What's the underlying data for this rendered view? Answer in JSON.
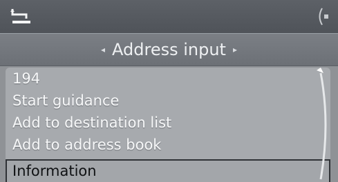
{
  "header": {
    "back_icon": "return-arrow-icon",
    "scroll_icon": "controller-direction-icon"
  },
  "title": {
    "text": "Address input",
    "left_arrow": "◂",
    "right_arrow": "▸"
  },
  "menu": {
    "items": [
      {
        "label": "194"
      },
      {
        "label": "Start guidance"
      },
      {
        "label": "Add to destination list"
      },
      {
        "label": "Add to address book"
      }
    ],
    "selected": {
      "label": "Information"
    }
  }
}
